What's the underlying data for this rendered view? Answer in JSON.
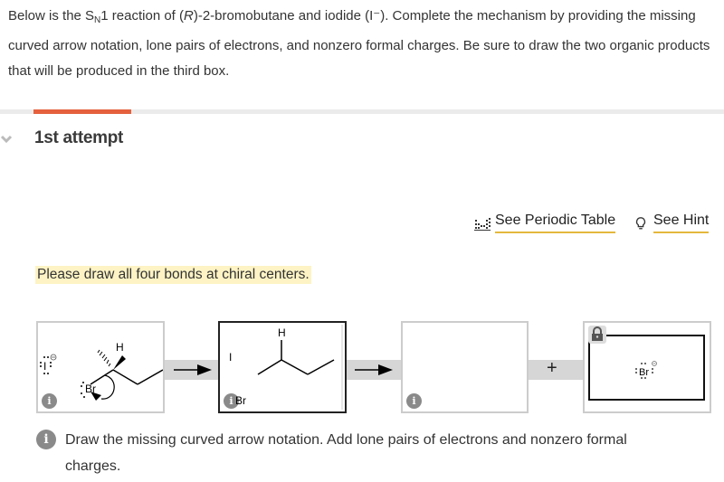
{
  "question": {
    "prefix": "Below is the S",
    "subscript": "N",
    "rest_line1": "1 reaction of (",
    "italic_R": "R",
    "rest_line1b": ")-2-bromobutane and iodide (I⁻). Complete the mechanism by providing the missing curved arrow notation, lone pairs of electrons, and nonzero formal charges.  Be sure to draw the two organic products that will be produced in the third box."
  },
  "attempt": {
    "label": "1st attempt",
    "progress_color": "#e5613d"
  },
  "links": {
    "periodic_table": "See Periodic Table",
    "hint": "See Hint",
    "underline_color": "#e4b83c"
  },
  "banner": {
    "text": "Please draw all four bonds at chiral centers."
  },
  "mechanism": {
    "box1": {
      "nucleophile": "I",
      "leaving_group": "Br",
      "substituent": "H",
      "nucleophile_charge": "⊖"
    },
    "box2": {
      "iodide": "I",
      "hydrogen": "H",
      "bromide": "Br"
    },
    "box3": {},
    "plus": "+",
    "box4": {
      "ion": "Br",
      "charge": "⊖",
      "locked": true
    }
  },
  "instruction": {
    "text": "Draw the missing curved arrow notation. Add lone pairs of electrons and nonzero formal charges."
  },
  "icons": {
    "info": "i"
  }
}
